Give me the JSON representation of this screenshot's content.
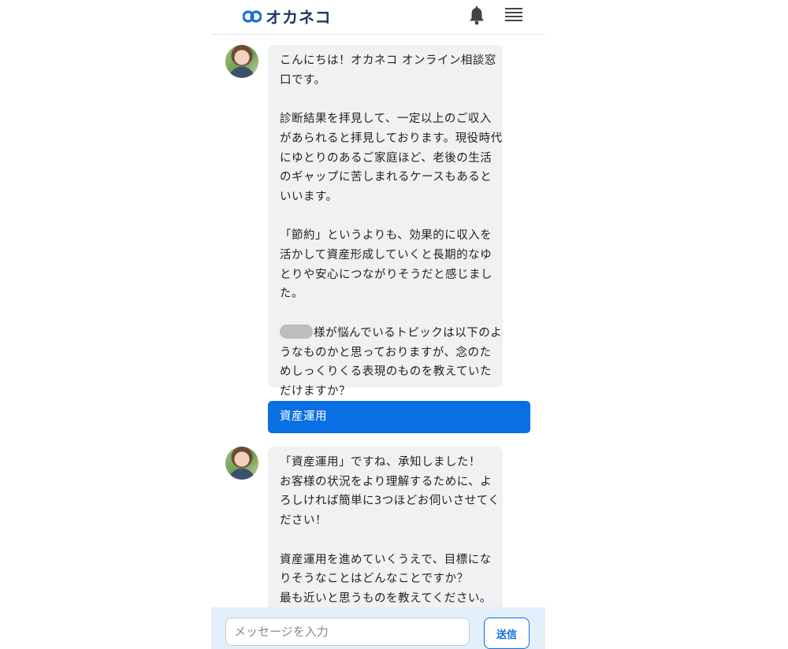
{
  "header": {
    "logo_text": "オカネコ",
    "bell_icon": "bell-icon",
    "menu_icon": "hamburger-menu-icon",
    "brand_color": "#1a6fd8"
  },
  "messages": [
    {
      "from": "advisor",
      "avatar_icon": "advisor-avatar",
      "paragraphs": [
        "こんにちは！オカネコ オンライン相談窓口です。",
        "診断結果を拝見して、一定以上のご収入があられると拝見しております。現役時代にゆとりのあるご家庭ほど、老後の生活のギャップに苦しまれるケースもあるといいます。",
        "「節約」というよりも、効果的に収入を活かして資産形成していくと長期的なゆとりや安心につながりそうだと感じました。",
        "様が悩んでいるトピックは以下のようなものかと思っておりますが、念のためしっくりくる表現のものを教えていただけますか？"
      ]
    },
    {
      "from": "user",
      "text": "資産運用"
    },
    {
      "from": "advisor",
      "avatar_icon": "advisor-avatar",
      "paragraphs": [
        "「資産運用」ですね、承知しました！\nお客様の状況をより理解するために、よろしければ簡単に3つほどお伺いさせてください！",
        "資産運用を進めていくうえで、目標になりそうなことはどんなことですか？\n最も近いと思うものを教えてください。"
      ]
    }
  ],
  "composer": {
    "placeholder": "メッセージを入力",
    "value": "",
    "send_label": "送信"
  },
  "colors": {
    "user_bubble": "#0a6fe2",
    "advisor_bubble": "#f0f1f2",
    "composer_bg": "#e3effb"
  }
}
